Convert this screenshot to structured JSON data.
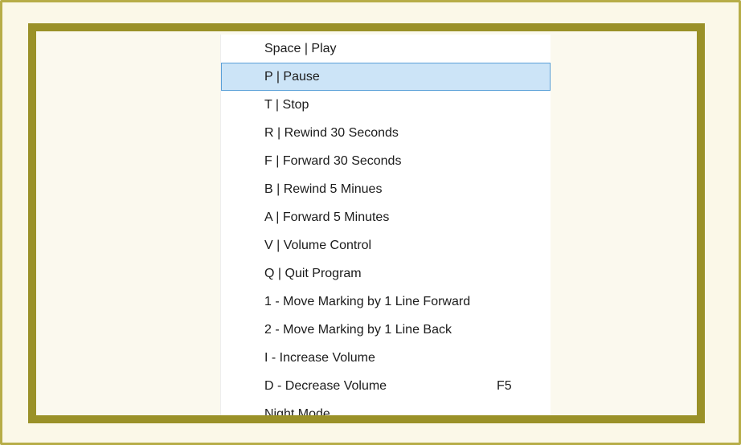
{
  "menu": {
    "items": [
      {
        "label": "Space | Play",
        "shortcut": "",
        "selected": false
      },
      {
        "label": "P | Pause",
        "shortcut": "",
        "selected": true
      },
      {
        "label": "T | Stop",
        "shortcut": "",
        "selected": false
      },
      {
        "label": "R | Rewind 30 Seconds",
        "shortcut": "",
        "selected": false
      },
      {
        "label": "F | Forward 30 Seconds",
        "shortcut": "",
        "selected": false
      },
      {
        "label": "B | Rewind 5 Minues",
        "shortcut": "",
        "selected": false
      },
      {
        "label": "A | Forward 5 Minutes",
        "shortcut": "",
        "selected": false
      },
      {
        "label": "V | Volume Control",
        "shortcut": "",
        "selected": false
      },
      {
        "label": "Q | Quit Program",
        "shortcut": "",
        "selected": false
      },
      {
        "label": "1 - Move Marking by 1 Line Forward",
        "shortcut": "",
        "selected": false
      },
      {
        "label": "2 - Move Marking by 1 Line Back",
        "shortcut": "",
        "selected": false
      },
      {
        "label": "I - Increase Volume",
        "shortcut": "",
        "selected": false
      },
      {
        "label": "D - Decrease Volume",
        "shortcut": "F5",
        "selected": false
      },
      {
        "label": "Night Mode",
        "shortcut": "",
        "selected": false
      }
    ]
  },
  "colors": {
    "outer_background": "#fbf8e8",
    "outer_border": "#b7ad48",
    "inner_border": "#9a9128",
    "menu_background": "#ffffff",
    "selection_fill": "#cce4f7",
    "selection_border": "#5aa0d8",
    "text": "#1b1b1b"
  }
}
